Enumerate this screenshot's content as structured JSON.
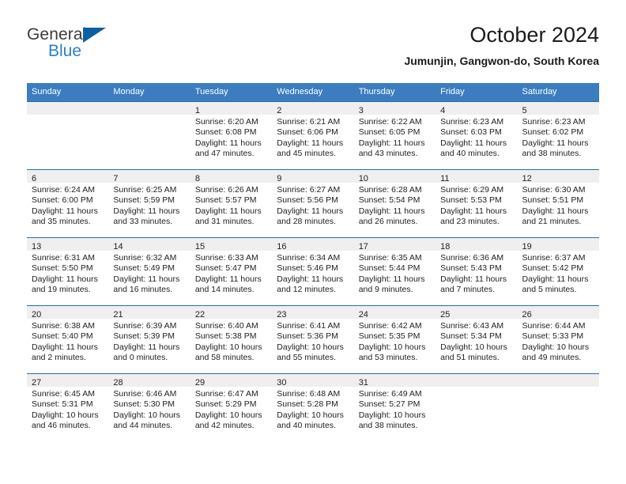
{
  "brand": {
    "name_part1": "General",
    "name_part2": "Blue",
    "logo_icon": "blue-triangle-logo",
    "accent_color": "#2a7fc9",
    "triangle_color": "#0b5fa5"
  },
  "header": {
    "title": "October 2024",
    "subtitle": "Jumunjin, Gangwon-do, South Korea"
  },
  "calendar": {
    "header_bg": "#3b7dbf",
    "daynum_bg": "#efefef",
    "row_border": "#2a6db5",
    "weekdays": [
      "Sunday",
      "Monday",
      "Tuesday",
      "Wednesday",
      "Thursday",
      "Friday",
      "Saturday"
    ],
    "weeks": [
      [
        {
          "day": "",
          "lines": []
        },
        {
          "day": "",
          "lines": []
        },
        {
          "day": "1",
          "lines": [
            "Sunrise: 6:20 AM",
            "Sunset: 6:08 PM",
            "Daylight: 11 hours",
            "and 47 minutes."
          ]
        },
        {
          "day": "2",
          "lines": [
            "Sunrise: 6:21 AM",
            "Sunset: 6:06 PM",
            "Daylight: 11 hours",
            "and 45 minutes."
          ]
        },
        {
          "day": "3",
          "lines": [
            "Sunrise: 6:22 AM",
            "Sunset: 6:05 PM",
            "Daylight: 11 hours",
            "and 43 minutes."
          ]
        },
        {
          "day": "4",
          "lines": [
            "Sunrise: 6:23 AM",
            "Sunset: 6:03 PM",
            "Daylight: 11 hours",
            "and 40 minutes."
          ]
        },
        {
          "day": "5",
          "lines": [
            "Sunrise: 6:23 AM",
            "Sunset: 6:02 PM",
            "Daylight: 11 hours",
            "and 38 minutes."
          ]
        }
      ],
      [
        {
          "day": "6",
          "lines": [
            "Sunrise: 6:24 AM",
            "Sunset: 6:00 PM",
            "Daylight: 11 hours",
            "and 35 minutes."
          ]
        },
        {
          "day": "7",
          "lines": [
            "Sunrise: 6:25 AM",
            "Sunset: 5:59 PM",
            "Daylight: 11 hours",
            "and 33 minutes."
          ]
        },
        {
          "day": "8",
          "lines": [
            "Sunrise: 6:26 AM",
            "Sunset: 5:57 PM",
            "Daylight: 11 hours",
            "and 31 minutes."
          ]
        },
        {
          "day": "9",
          "lines": [
            "Sunrise: 6:27 AM",
            "Sunset: 5:56 PM",
            "Daylight: 11 hours",
            "and 28 minutes."
          ]
        },
        {
          "day": "10",
          "lines": [
            "Sunrise: 6:28 AM",
            "Sunset: 5:54 PM",
            "Daylight: 11 hours",
            "and 26 minutes."
          ]
        },
        {
          "day": "11",
          "lines": [
            "Sunrise: 6:29 AM",
            "Sunset: 5:53 PM",
            "Daylight: 11 hours",
            "and 23 minutes."
          ]
        },
        {
          "day": "12",
          "lines": [
            "Sunrise: 6:30 AM",
            "Sunset: 5:51 PM",
            "Daylight: 11 hours",
            "and 21 minutes."
          ]
        }
      ],
      [
        {
          "day": "13",
          "lines": [
            "Sunrise: 6:31 AM",
            "Sunset: 5:50 PM",
            "Daylight: 11 hours",
            "and 19 minutes."
          ]
        },
        {
          "day": "14",
          "lines": [
            "Sunrise: 6:32 AM",
            "Sunset: 5:49 PM",
            "Daylight: 11 hours",
            "and 16 minutes."
          ]
        },
        {
          "day": "15",
          "lines": [
            "Sunrise: 6:33 AM",
            "Sunset: 5:47 PM",
            "Daylight: 11 hours",
            "and 14 minutes."
          ]
        },
        {
          "day": "16",
          "lines": [
            "Sunrise: 6:34 AM",
            "Sunset: 5:46 PM",
            "Daylight: 11 hours",
            "and 12 minutes."
          ]
        },
        {
          "day": "17",
          "lines": [
            "Sunrise: 6:35 AM",
            "Sunset: 5:44 PM",
            "Daylight: 11 hours",
            "and 9 minutes."
          ]
        },
        {
          "day": "18",
          "lines": [
            "Sunrise: 6:36 AM",
            "Sunset: 5:43 PM",
            "Daylight: 11 hours",
            "and 7 minutes."
          ]
        },
        {
          "day": "19",
          "lines": [
            "Sunrise: 6:37 AM",
            "Sunset: 5:42 PM",
            "Daylight: 11 hours",
            "and 5 minutes."
          ]
        }
      ],
      [
        {
          "day": "20",
          "lines": [
            "Sunrise: 6:38 AM",
            "Sunset: 5:40 PM",
            "Daylight: 11 hours",
            "and 2 minutes."
          ]
        },
        {
          "day": "21",
          "lines": [
            "Sunrise: 6:39 AM",
            "Sunset: 5:39 PM",
            "Daylight: 11 hours",
            "and 0 minutes."
          ]
        },
        {
          "day": "22",
          "lines": [
            "Sunrise: 6:40 AM",
            "Sunset: 5:38 PM",
            "Daylight: 10 hours",
            "and 58 minutes."
          ]
        },
        {
          "day": "23",
          "lines": [
            "Sunrise: 6:41 AM",
            "Sunset: 5:36 PM",
            "Daylight: 10 hours",
            "and 55 minutes."
          ]
        },
        {
          "day": "24",
          "lines": [
            "Sunrise: 6:42 AM",
            "Sunset: 5:35 PM",
            "Daylight: 10 hours",
            "and 53 minutes."
          ]
        },
        {
          "day": "25",
          "lines": [
            "Sunrise: 6:43 AM",
            "Sunset: 5:34 PM",
            "Daylight: 10 hours",
            "and 51 minutes."
          ]
        },
        {
          "day": "26",
          "lines": [
            "Sunrise: 6:44 AM",
            "Sunset: 5:33 PM",
            "Daylight: 10 hours",
            "and 49 minutes."
          ]
        }
      ],
      [
        {
          "day": "27",
          "lines": [
            "Sunrise: 6:45 AM",
            "Sunset: 5:31 PM",
            "Daylight: 10 hours",
            "and 46 minutes."
          ]
        },
        {
          "day": "28",
          "lines": [
            "Sunrise: 6:46 AM",
            "Sunset: 5:30 PM",
            "Daylight: 10 hours",
            "and 44 minutes."
          ]
        },
        {
          "day": "29",
          "lines": [
            "Sunrise: 6:47 AM",
            "Sunset: 5:29 PM",
            "Daylight: 10 hours",
            "and 42 minutes."
          ]
        },
        {
          "day": "30",
          "lines": [
            "Sunrise: 6:48 AM",
            "Sunset: 5:28 PM",
            "Daylight: 10 hours",
            "and 40 minutes."
          ]
        },
        {
          "day": "31",
          "lines": [
            "Sunrise: 6:49 AM",
            "Sunset: 5:27 PM",
            "Daylight: 10 hours",
            "and 38 minutes."
          ]
        },
        {
          "day": "",
          "lines": []
        },
        {
          "day": "",
          "lines": []
        }
      ]
    ]
  }
}
